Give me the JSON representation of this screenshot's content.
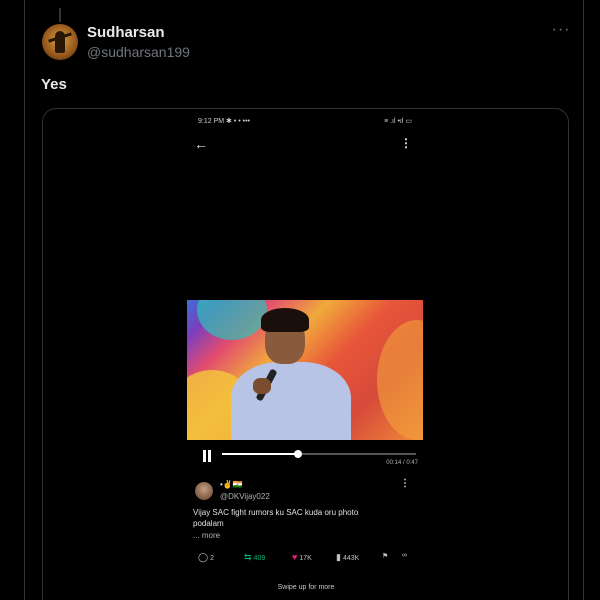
{
  "tweet": {
    "display_name": "Sudharsan",
    "handle": "@sudharsan199",
    "more_icon": "more-horizontal-icon",
    "text": "Yes"
  },
  "embedded": {
    "status_bar": {
      "left": "9:12 PM ✱ • • •••",
      "right": "≡ .ıl •ıl ▭"
    },
    "video": {
      "progress": 0.39,
      "time": "00:14 / 0:47"
    },
    "post": {
      "name": "•✌🇮🇳",
      "handle": "@DKVijay022",
      "text": "Vijay SAC fight rumors ku SAC kuda oru photo podalam",
      "more": "... more"
    },
    "actions": {
      "replies": "2",
      "reposts": "409",
      "likes": "17K",
      "views": "443K"
    },
    "swipe_hint": "Swipe up for more"
  },
  "colors": {
    "background": "#000000",
    "text": "#e7e9ea",
    "secondary": "#71767b",
    "border": "#2f3336",
    "repost": "#00ba7c",
    "like": "#f91880"
  }
}
